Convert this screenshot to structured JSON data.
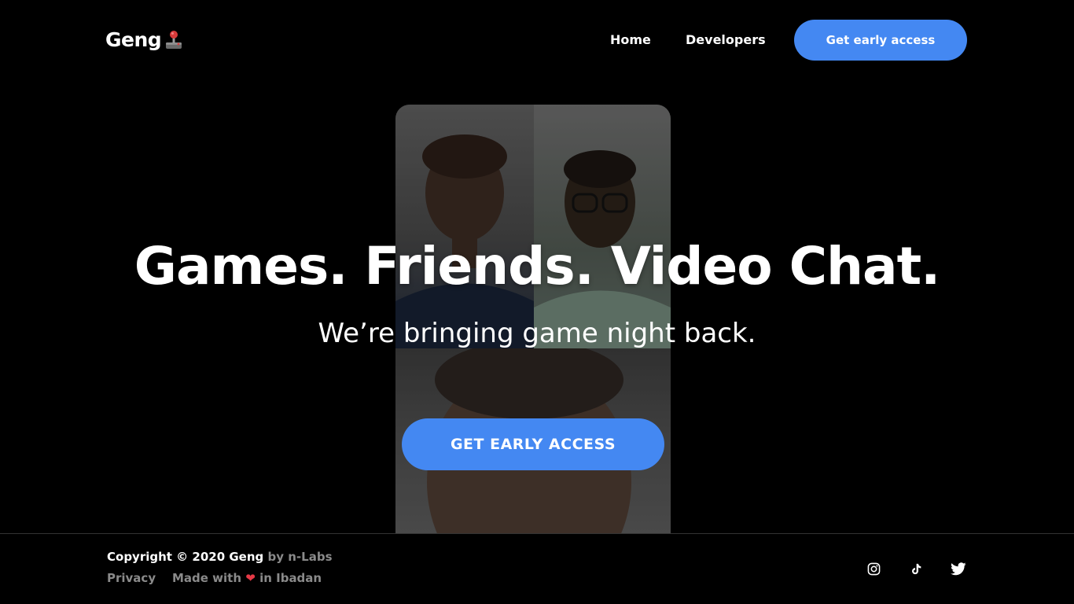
{
  "header": {
    "logo_text": "Geng",
    "logo_icon": "joystick-icon",
    "nav": [
      "Home",
      "Developers"
    ],
    "cta_label": "Get early access"
  },
  "hero": {
    "headline": "Games. Friends. Video Chat.",
    "subhead": "We’re bringing game night back.",
    "cta_label": "GET EARLY ACCESS"
  },
  "footer": {
    "copyright": "Copyright © 2020 Geng",
    "by": "by n-Labs",
    "privacy": "Privacy",
    "made_prefix": "Made with",
    "made_suffix": "in Ibadan",
    "heart_glyph": "❤",
    "social": [
      "instagram-icon",
      "tiktok-icon",
      "twitter-icon"
    ]
  },
  "colors": {
    "background": "#000000",
    "accent": "#4488f2",
    "muted_text": "#8a8a8a",
    "heart": "#e63946"
  }
}
